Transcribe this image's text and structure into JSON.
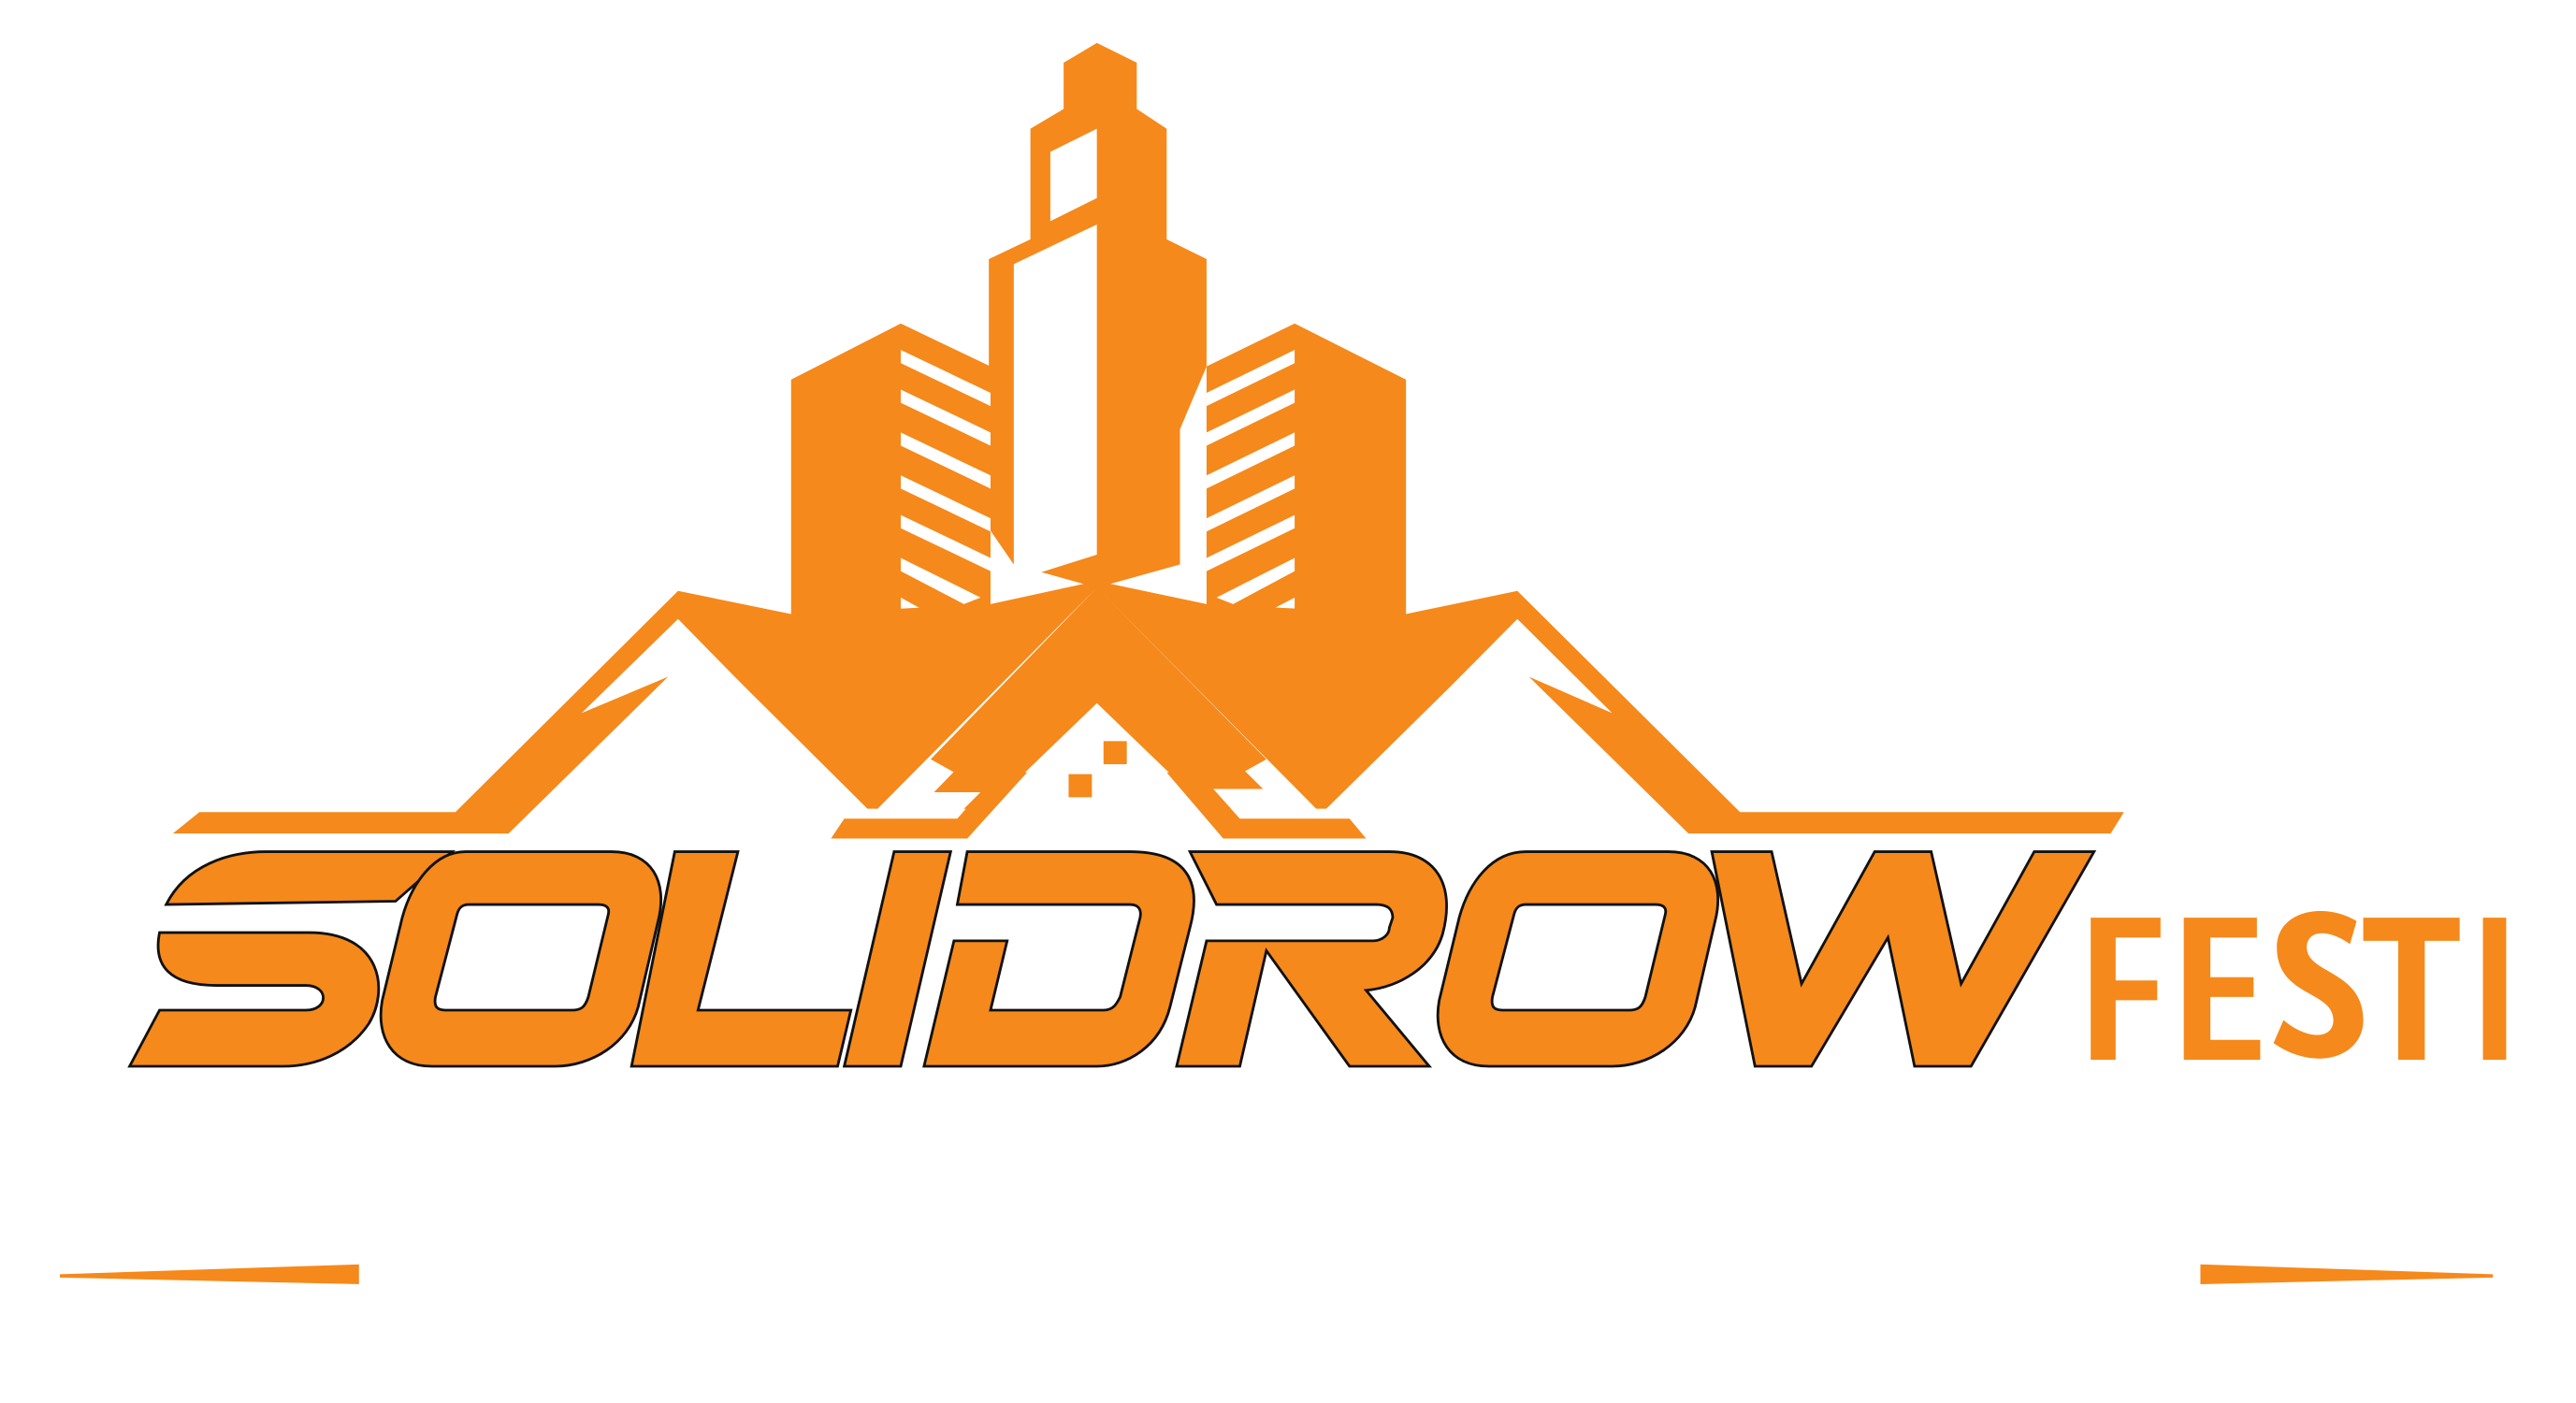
{
  "logo": {
    "wordmark": "SOLIDROW",
    "suffix": "FESTI",
    "brand_color": "#F5891B",
    "outline_color": "#111111",
    "background": "#FFFFFF"
  },
  "icons": {
    "skyline": "city-skyline-icon",
    "rooftops": "house-rooftops-icon"
  }
}
